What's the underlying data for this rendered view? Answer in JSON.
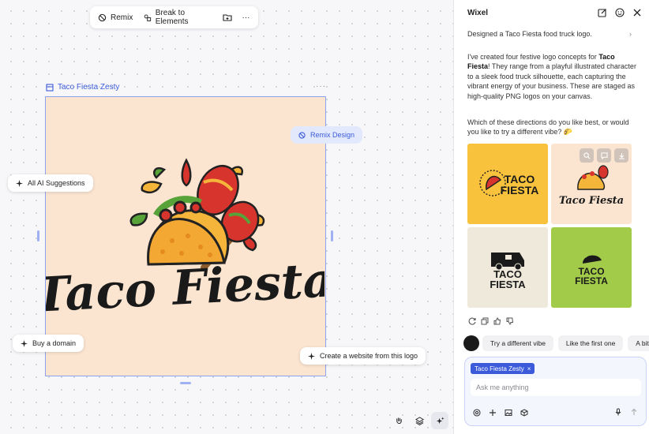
{
  "toolbar": {
    "remix_label": "Remix",
    "break_label": "Break to Elements",
    "more_label": "···"
  },
  "frame": {
    "title": "Taco Fiesta Zesty",
    "more": "···",
    "logo_text": "Taco Fiesta"
  },
  "floating": {
    "remix_design": "Remix Design",
    "all_ai_suggestions": "All AI Suggestions",
    "buy_domain": "Buy a domain",
    "create_website": "Create a website from this logo"
  },
  "panel": {
    "title": "Wixel",
    "summary": "Designed a Taco Fiesta food truck logo.",
    "message_part1": "I've created four festive logo concepts for ",
    "message_bold": "Taco Fiesta",
    "message_part2": "! They range from a playful illustrated character to a sleek food truck silhouette, each capturing the vibrant energy of your business. These are staged as high-quality PNG logos on your canvas.",
    "question": "Which of these directions do you like best, or would you like to try a different vibe? 🌮",
    "tiles": [
      {
        "line1": "TACO",
        "line2": "FIESTA",
        "bg": "#f9c23c"
      },
      {
        "line1": "Taco Fiesta",
        "line2": "",
        "bg": "#fbe5d1"
      },
      {
        "line1": "TACO",
        "line2": "FIESTA",
        "bg": "#efe9dc"
      },
      {
        "line1": "TACO",
        "line2": "FIESTA",
        "bg": "#a3cb4a"
      }
    ],
    "chips": [
      "Try a different vibe",
      "Like the first one",
      "A bit more"
    ],
    "composer": {
      "tag": "Taco Fiesta Zesty",
      "tag_close": "×",
      "placeholder": "Ask me anything"
    }
  },
  "colors": {
    "accent": "#3b5bdb",
    "frame_bg": "#fbe5d1",
    "taco_yellow": "#f5b43a",
    "red": "#d8342e",
    "green": "#58a23a"
  }
}
